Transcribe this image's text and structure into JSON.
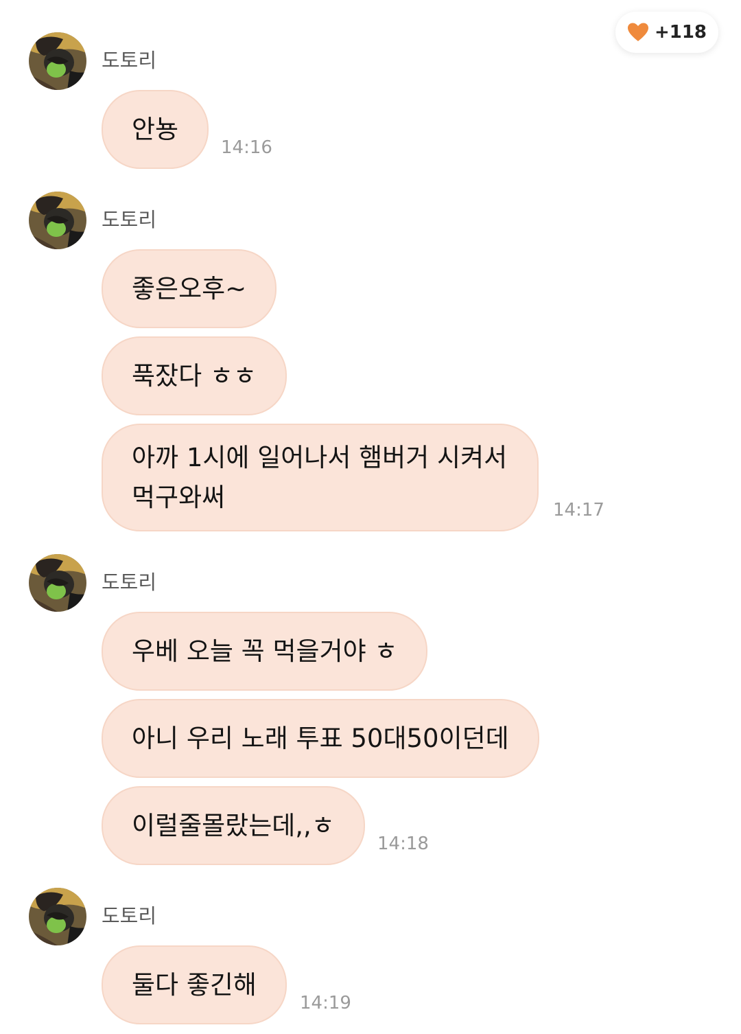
{
  "reactions": {
    "icon": "heart-icon",
    "icon_color": "#ef8a3c",
    "count": "+118"
  },
  "colors": {
    "bubble": "#fbe4d9",
    "bubble_border": "#f6d6c6",
    "timestamp": "#9a9a9a",
    "sender": "#5a5a5a"
  },
  "groups": [
    {
      "sender": "도토리",
      "time": "14:16",
      "messages": [
        "안뇽"
      ]
    },
    {
      "sender": "도토리",
      "time": "14:17",
      "messages": [
        "좋은오후~",
        "푹잤다 ㅎㅎ",
        "아까 1시에 일어나서 햄버거 시켜서\n먹구와써"
      ]
    },
    {
      "sender": "도토리",
      "time": "14:18",
      "messages": [
        "우베 오늘 꼭 먹을거야 ㅎ",
        "아니 우리 노래 투표 50대50이던데",
        "이럴줄몰랐는데,,ㅎ"
      ]
    },
    {
      "sender": "도토리",
      "time": "14:19",
      "messages": [
        "둘다 좋긴해"
      ]
    }
  ]
}
